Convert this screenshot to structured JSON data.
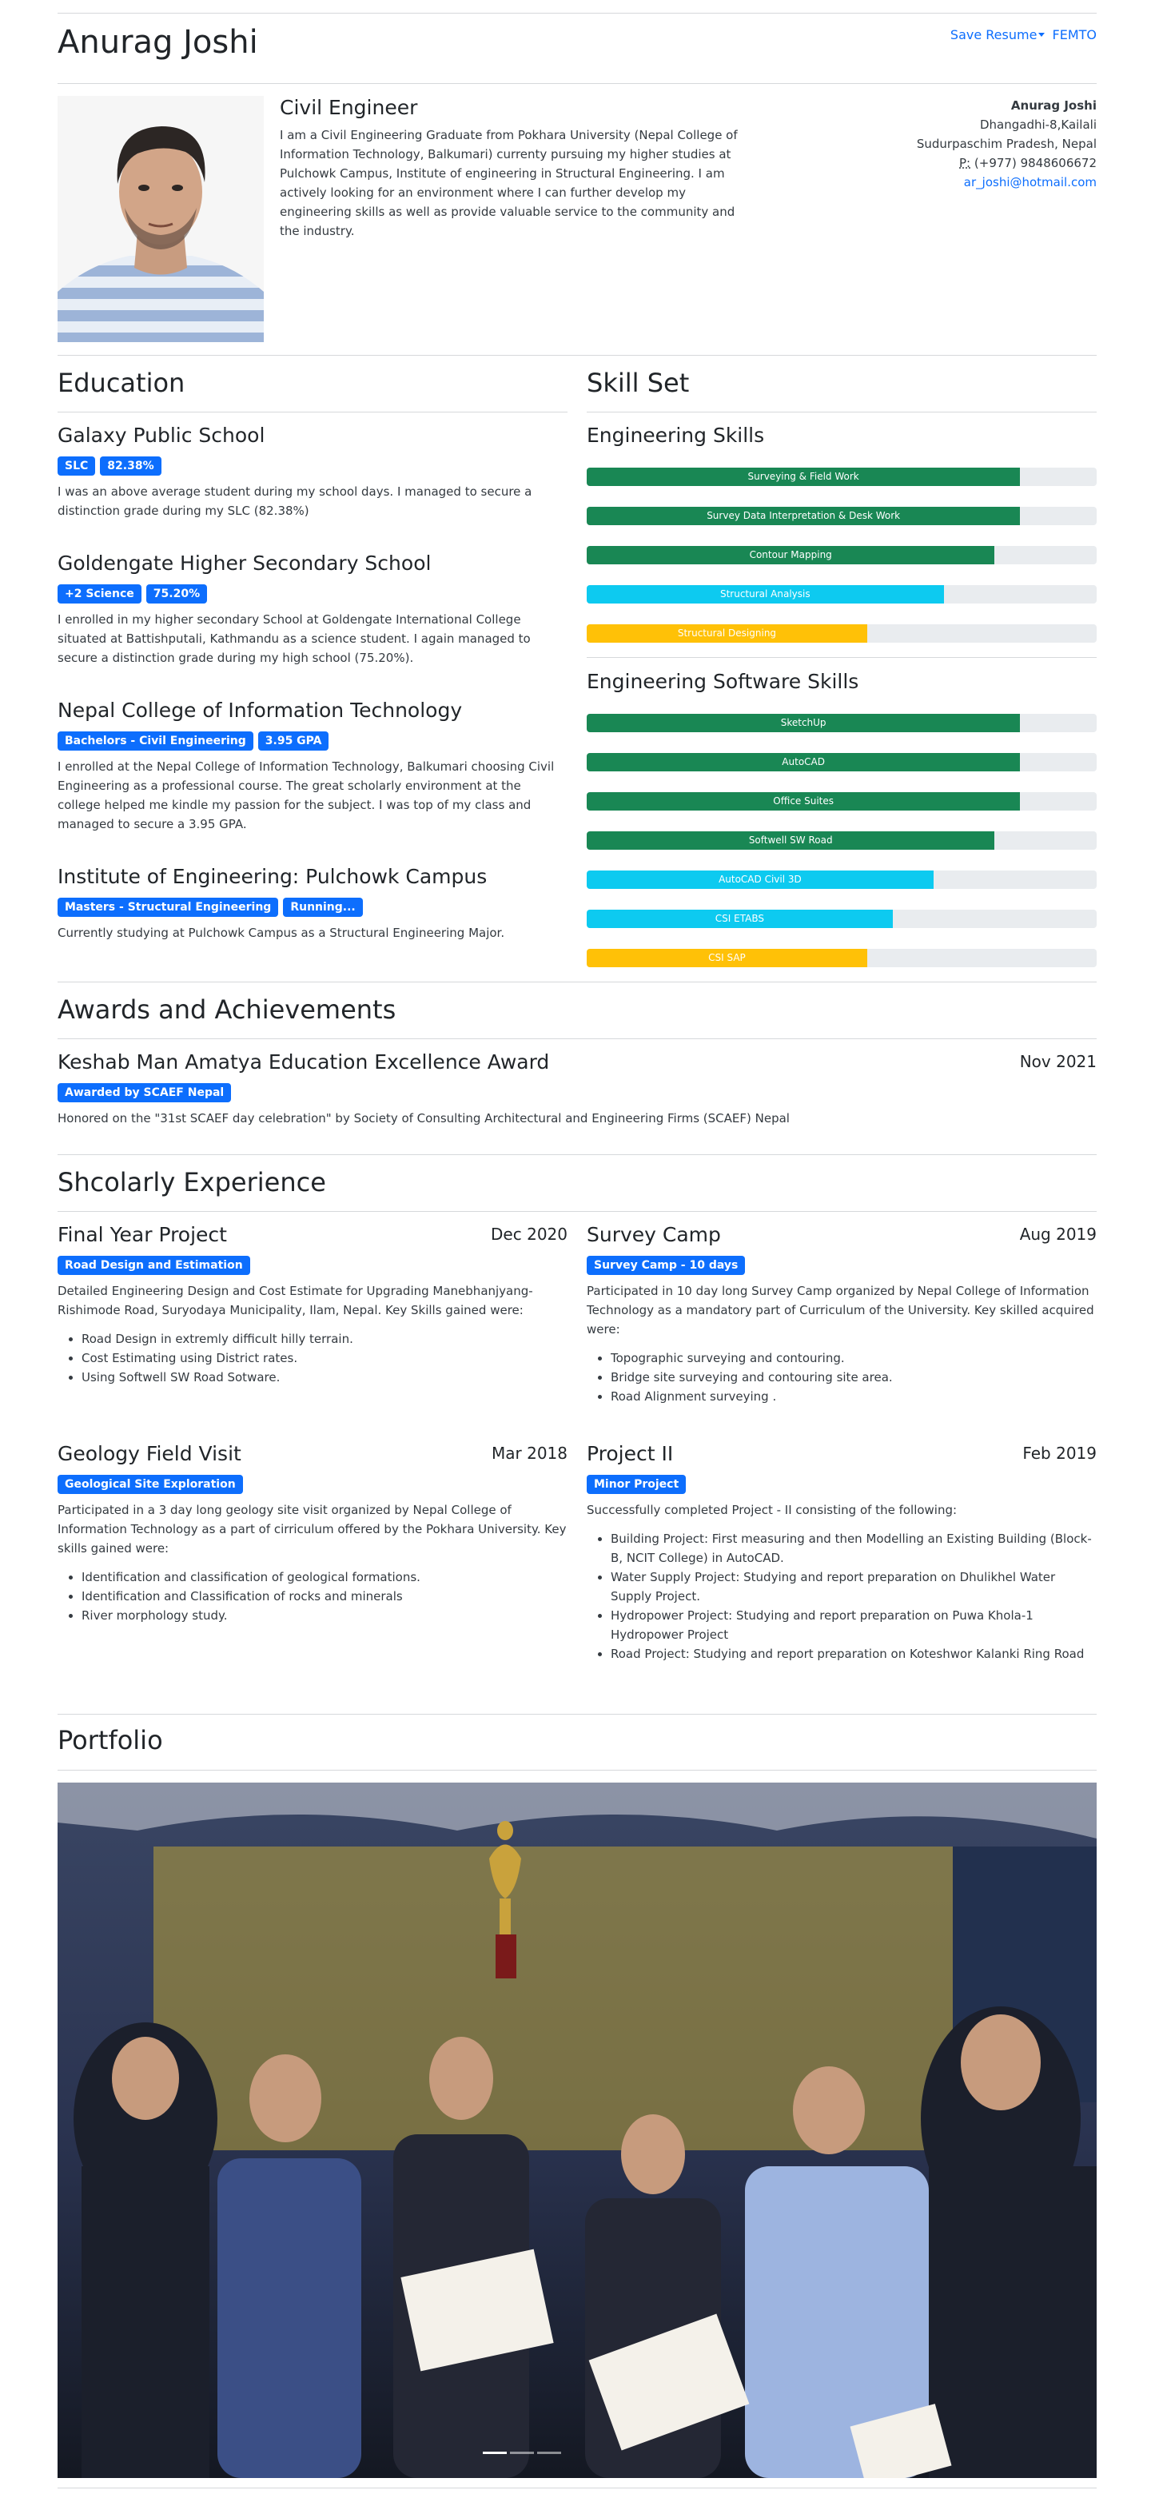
{
  "header": {
    "name": "Anurag Joshi",
    "save_label": "Save Resume",
    "femto_label": "FEMTO"
  },
  "profile": {
    "title": "Civil Engineer",
    "summary": "I am a Civil Engineering Graduate from Pokhara University (Nepal College of Information Technology, Balkumari) currenty pursuing my higher studies at Pulchowk Campus, Institute of engineering in Structural Engineering. I am actively looking for an environment where I can further develop my engineering skills as well as provide valuable service to the community and the industry.",
    "contact": {
      "name": "Anurag Joshi",
      "address1": "Dhangadhi-8,Kailali",
      "address2": "Sudurpaschim Pradesh, Nepal",
      "phone_prefix": "P:",
      "phone": " (+977) 9848606672",
      "email": "ar_joshi@hotmail.com"
    }
  },
  "education": {
    "heading": "Education",
    "items": [
      {
        "school": "Galaxy Public School",
        "badges": [
          "SLC",
          "82.38%"
        ],
        "text": "I was an above average student during my school days. I managed to secure a distinction grade during my SLC (82.38%)"
      },
      {
        "school": "Goldengate Higher Secondary School",
        "badges": [
          "+2 Science",
          "75.20%"
        ],
        "text": "I enrolled in my higher secondary School at Goldengate International College situated at Battishputali, Kathmandu as a science student. I again managed to secure a distinction grade during my high school (75.20%)."
      },
      {
        "school": "Nepal College of Information Technology",
        "badges": [
          "Bachelors - Civil Engineering",
          "3.95 GPA"
        ],
        "text": "I enrolled at the Nepal College of Information Technology, Balkumari choosing Civil Engineering as a professional course. The great scholarly environment at the college helped me kindle my passion for the subject. I was top of my class and managed to secure a 3.95 GPA."
      },
      {
        "school": "Institute of Engineering: Pulchowk Campus",
        "badges": [
          "Masters - Structural Engineering",
          "Running..."
        ],
        "text": "Currently studying at Pulchowk Campus as a Structural Engineering Major."
      }
    ]
  },
  "skills": {
    "heading": "Skill Set",
    "engineering": {
      "title": "Engineering Skills",
      "items": [
        {
          "label": "Surveying & Field Work",
          "value": 85,
          "color": "#198754"
        },
        {
          "label": "Survey Data Interpretation & Desk Work",
          "value": 85,
          "color": "#198754"
        },
        {
          "label": "Contour Mapping",
          "value": 80,
          "color": "#198754"
        },
        {
          "label": "Structural Analysis",
          "value": 70,
          "color": "#0dcaf0"
        },
        {
          "label": "Structural Designing",
          "value": 55,
          "color": "#ffc107"
        }
      ]
    },
    "software": {
      "title": "Engineering Software Skills",
      "items": [
        {
          "label": "SketchUp",
          "value": 85,
          "color": "#198754"
        },
        {
          "label": "AutoCAD",
          "value": 85,
          "color": "#198754"
        },
        {
          "label": "Office Suites",
          "value": 85,
          "color": "#198754"
        },
        {
          "label": "Softwell SW Road",
          "value": 80,
          "color": "#198754"
        },
        {
          "label": "AutoCAD Civil 3D",
          "value": 68,
          "color": "#0dcaf0"
        },
        {
          "label": "CSI ETABS",
          "value": 60,
          "color": "#0dcaf0"
        },
        {
          "label": "CSI SAP",
          "value": 55,
          "color": "#ffc107"
        }
      ]
    }
  },
  "awards": {
    "heading": "Awards and Achievements",
    "items": [
      {
        "title": "Keshab Man Amatya Education Excellence Award",
        "date": "Nov 2021",
        "badge": "Awarded by SCAEF Nepal",
        "text": "Honored on the \"31st SCAEF day celebration\" by Society of Consulting Architectural and Engineering Firms (SCAEF) Nepal"
      }
    ]
  },
  "experience": {
    "heading": "Shcolarly Experience",
    "items": [
      {
        "title": "Final Year Project",
        "date": "Dec 2020",
        "badge": "Road Design and Estimation",
        "text": "Detailed Engineering Design and Cost Estimate for Upgrading Manebhanjyang-Rishimode Road, Suryodaya Municipality, Ilam, Nepal. Key Skills gained were:",
        "bullets": [
          "Road Design in extremly difficult hilly terrain.",
          "Cost Estimating using District rates.",
          "Using Softwell SW Road Sotware."
        ]
      },
      {
        "title": "Survey Camp",
        "date": "Aug 2019",
        "badge": "Survey Camp - 10 days",
        "text": "Participated in 10 day long Survey Camp organized by Nepal College of Information Technology as a mandatory part of Curriculum of the University. Key skilled acquired were:",
        "bullets": [
          "Topographic surveying and contouring.",
          "Bridge site surveying and contouring site area.",
          "Road Alignment surveying  ."
        ]
      },
      {
        "title": "Geology Field Visit",
        "date": "Mar 2018",
        "badge": "Geological Site Exploration",
        "text": "Participated in a 3 day long geology site visit organized by Nepal College of Information Technology as a part of cirriculum offered by the Pokhara University. Key skills gained were:",
        "bullets": [
          "Identification and classification of geological formations.",
          "Identification and Classification of rocks and minerals",
          "River morphology study."
        ]
      },
      {
        "title": "Project II",
        "date": "Feb 2019",
        "badge": "Minor Project",
        "text": "Successfully completed Project - II consisting of the following:",
        "bullets": [
          "Building Project: First measuring and then Modelling an Existing Building (Block-B, NCIT College) in AutoCAD.",
          "Water Supply Project: Studying and report preparation on Dhulikhel Water Supply Project.",
          "Hydropower Project: Studying and report preparation on Puwa Khola-1 Hydropower Project",
          "Road Project: Studying and report preparation on Koteshwor Kalanki Ring Road"
        ]
      }
    ]
  },
  "portfolio": {
    "heading": "Portfolio",
    "slides": 3,
    "active_slide": 1
  }
}
